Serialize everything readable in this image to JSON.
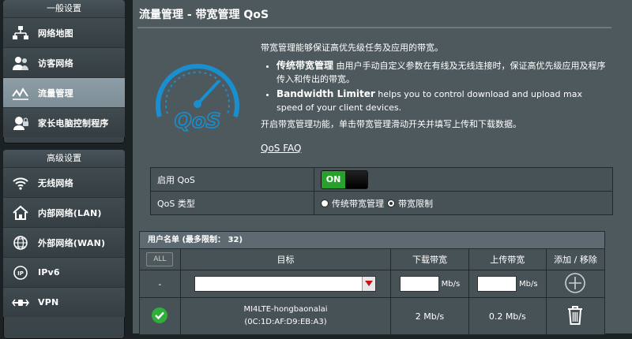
{
  "sidebar": {
    "general_title": "一般设置",
    "general_items": [
      {
        "label": "网络地图",
        "icon": "network-map-icon"
      },
      {
        "label": "访客网络",
        "icon": "guest-network-icon"
      },
      {
        "label": "流量管理",
        "icon": "traffic-manager-icon",
        "active": true
      },
      {
        "label": "家长电脑控制程序",
        "icon": "parental-control-icon"
      }
    ],
    "advanced_title": "高级设置",
    "advanced_items": [
      {
        "label": "无线网络",
        "icon": "wireless-icon"
      },
      {
        "label": "内部网络(LAN)",
        "icon": "lan-icon"
      },
      {
        "label": "外部网络(WAN)",
        "icon": "wan-icon"
      },
      {
        "label": "IPv6",
        "icon": "ipv6-icon"
      },
      {
        "label": "VPN",
        "icon": "vpn-icon"
      }
    ]
  },
  "main": {
    "title": "流量管理 - 带宽管理 QoS",
    "intro": "带宽管理能够保证高优先级任务及应用的带宽。",
    "bullet1_title": "传统带宽管理",
    "bullet1_text": "由用户手动自定义参数在有线及无线连接时，保证高优先级应用及程序传入和传出的带宽。",
    "bullet2_title": "Bandwidth Limiter",
    "bullet2_text": "helps you to control download and upload max speed of your client devices.",
    "instruction": "开启带宽管理功能，单击带宽管理滑动开关并填写上传和下载数据。",
    "faq_link": "QoS FAQ",
    "logo_text": "QoS"
  },
  "settings": {
    "enable_label": "启用 QoS",
    "toggle_label": "ON",
    "type_label": "QoS 类型",
    "type_options": [
      "传统带宽管理",
      "带宽限制"
    ],
    "type_selected": "带宽限制"
  },
  "user_list": {
    "header": "用户名单 (最多限制： 32)",
    "all_button": "ALL",
    "columns": [
      "目标",
      "下载带宽",
      "上传带宽",
      "添加 / 移除"
    ],
    "input_row": {
      "index": "-",
      "target": "",
      "download": "",
      "upload": "",
      "unit": "Mb/s"
    },
    "rows": [
      {
        "name": "MI4LTE-hongbaonalai",
        "mac": "(0C:1D:AF:D9:EB:A3)",
        "download": "2 Mb/s",
        "upload": "0.2 Mb/s"
      }
    ]
  },
  "colors": {
    "accent": "#27a02e",
    "active_menu": "#8e9ea7",
    "logo": "#1a8fd0"
  }
}
